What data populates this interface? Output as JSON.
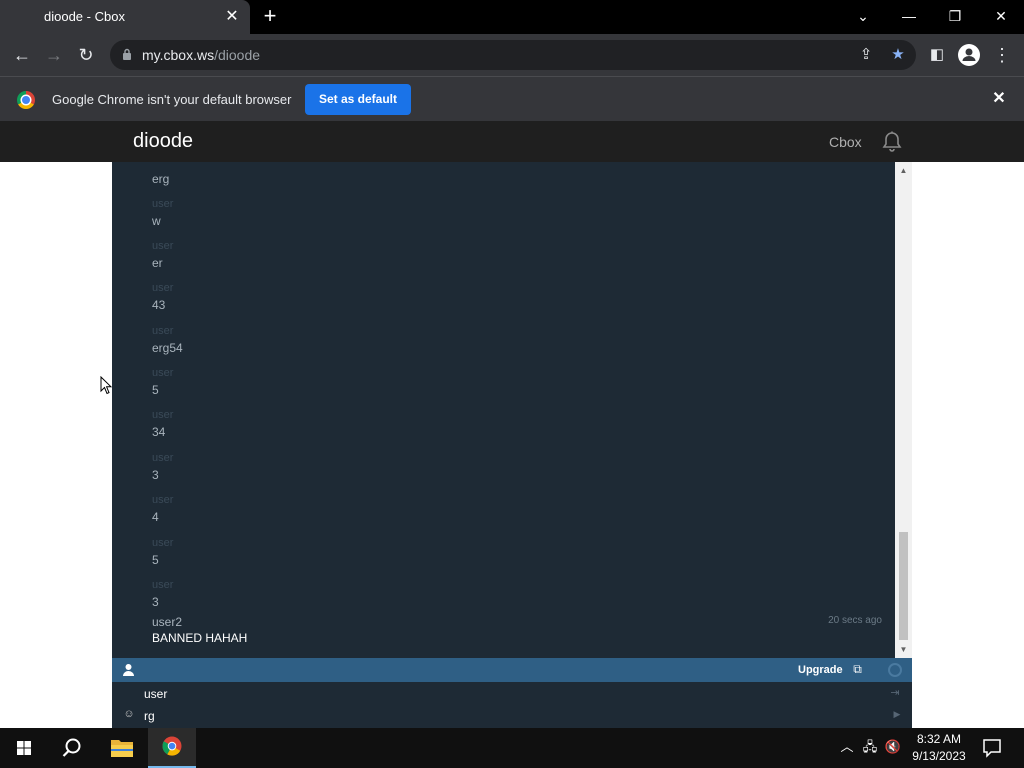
{
  "browser": {
    "tab_title": "dioode - Cbox",
    "url_host": "my.cbox.ws",
    "url_path": "/dioode",
    "infobar_text": "Google Chrome isn't your default browser",
    "infobar_button": "Set as default"
  },
  "site": {
    "title": "dioode",
    "nav_cbox": "Cbox"
  },
  "chat": {
    "messages": [
      {
        "user": "",
        "text": "erg"
      },
      {
        "user": "user",
        "text": "w"
      },
      {
        "user": "user",
        "text": "er"
      },
      {
        "user": "user",
        "text": "43"
      },
      {
        "user": "user",
        "text": "erg54"
      },
      {
        "user": "user",
        "text": "5"
      },
      {
        "user": "user",
        "text": "34"
      },
      {
        "user": "user",
        "text": "3"
      },
      {
        "user": "user",
        "text": "4"
      },
      {
        "user": "user",
        "text": "5"
      },
      {
        "user": "user",
        "text": "3"
      },
      {
        "user": "user2",
        "text": "BANNED HAHAH",
        "time": "20 secs ago"
      }
    ],
    "upgrade_label": "Upgrade",
    "name_value": "user",
    "message_value": "rg"
  },
  "taskbar": {
    "time": "8:32 AM",
    "date": "9/13/2023"
  },
  "icons": {
    "browser": [
      "chrome-icon",
      "close-icon",
      "plus-icon",
      "chevron-down-icon",
      "minimize-icon",
      "restore-icon",
      "back-icon",
      "forward-icon",
      "reload-icon",
      "lock-icon",
      "share-icon",
      "star-icon",
      "sidepanel-icon",
      "profile-icon",
      "menu-icon"
    ],
    "site": [
      "bell-icon",
      "user-icon",
      "external-link-icon",
      "refresh-icon",
      "emoji-icon",
      "login-icon",
      "send-icon"
    ],
    "taskbar": [
      "windows-start-icon",
      "search-icon",
      "file-explorer-icon",
      "chrome-icon",
      "tray-chevron-icon",
      "network-icon",
      "volume-muted-icon",
      "notification-icon"
    ]
  },
  "colors": {
    "chat_bg": "#1e2a35",
    "control_bar": "#2f5f85",
    "accent_button": "#1a73e8",
    "bookmark_star": "#8ab4f8"
  }
}
